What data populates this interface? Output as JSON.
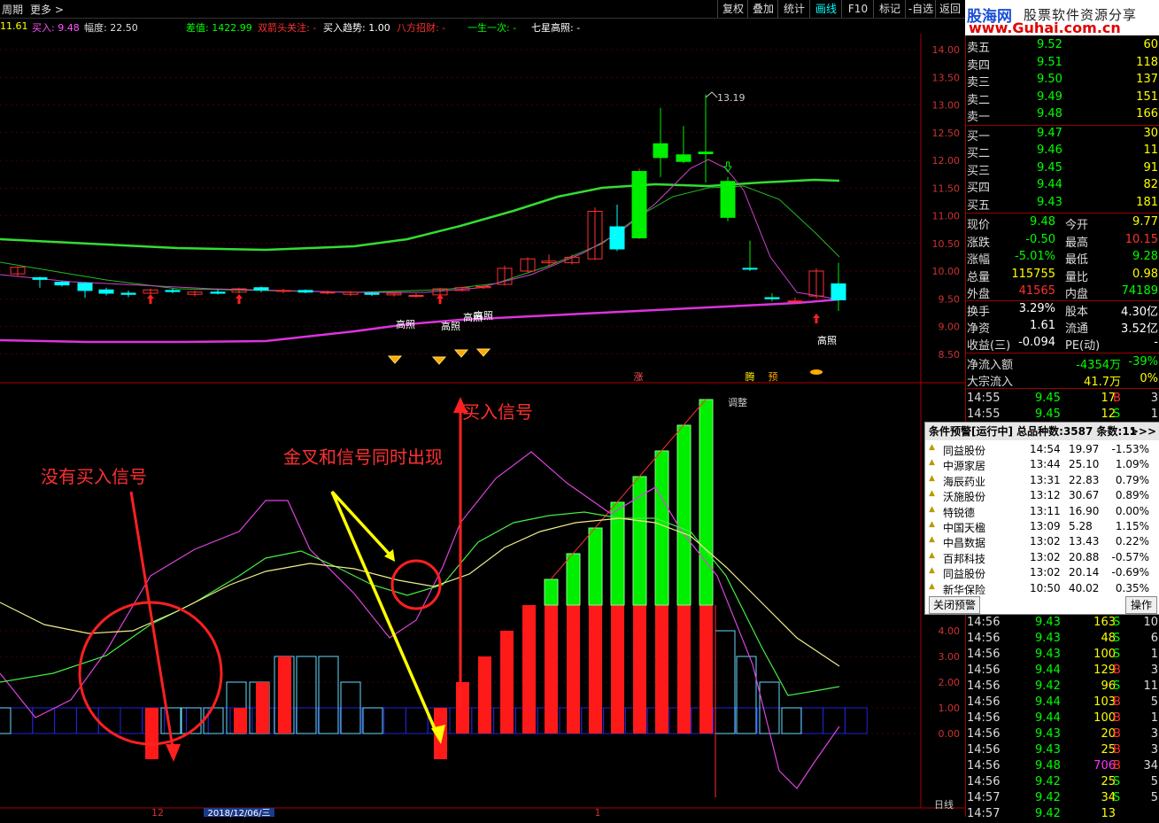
{
  "toolbar": {
    "left_items": [
      "周期",
      "更多 >"
    ],
    "buttons": [
      {
        "label": "复权",
        "active": false
      },
      {
        "label": "叠加",
        "active": false
      },
      {
        "label": "统计",
        "active": false
      },
      {
        "label": "画线",
        "active": true
      },
      {
        "label": "F10",
        "active": false
      },
      {
        "label": "标记",
        "active": false
      },
      {
        "label": "-自选",
        "active": false
      },
      {
        "label": "返回",
        "active": false
      }
    ]
  },
  "infobar": [
    {
      "text": "11.61",
      "color": "#ffff00"
    },
    {
      "text": "买入: 9.48",
      "color": "#ff55ff"
    },
    {
      "text": "幅度: 22.50",
      "color": "#dddddd"
    },
    {
      "text": "差值: 1422.99",
      "color": "#00ff00"
    },
    {
      "text": "双箭头关注: -",
      "color": "#ff3030"
    },
    {
      "text": "买入趋势: 1.00",
      "color": "#ffffff"
    },
    {
      "text": "八方招财: -",
      "color": "#ff3030"
    },
    {
      "text": "一生一次: -",
      "color": "#00ff00"
    },
    {
      "text": "七星高照: -",
      "color": "#ffffff"
    }
  ],
  "price_axis": [
    "14.00",
    "13.50",
    "13.00",
    "12.50",
    "12.00",
    "11.50",
    "11.00",
    "10.50",
    "10.00",
    "9.50",
    "9.00",
    "8.50"
  ],
  "indicator_axis": [
    "4.00",
    "3.00",
    "2.00",
    "1.00",
    "0.00"
  ],
  "chart_labels": {
    "high_label": "13.19",
    "gaozhao": [
      "高照",
      "高照",
      "高照",
      "高照",
      "高照"
    ],
    "zhang": "涨",
    "teng": "腾",
    "yu": "预",
    "date_label": "2018/12/06/三",
    "axis_tick_12": "12",
    "axis_tick_1": "1",
    "period": "日线",
    "ind_top_label": "调整"
  },
  "annotations": {
    "no_buy_signal": "没有买入信号",
    "golden_cross": "金叉和信号同时出现",
    "buy_signal": "买入信号"
  },
  "logo": {
    "name": "股海网",
    "slogan": "股票软件资源分享",
    "url": "www.Guhai.com.cn"
  },
  "quote_book": [
    {
      "label": "卖五",
      "price": "9.52",
      "vol": "60"
    },
    {
      "label": "卖四",
      "price": "9.51",
      "vol": "118"
    },
    {
      "label": "卖三",
      "price": "9.50",
      "vol": "137"
    },
    {
      "label": "卖二",
      "price": "9.49",
      "vol": "151"
    },
    {
      "label": "卖一",
      "price": "9.48",
      "vol": "166"
    },
    {
      "label": "买一",
      "price": "9.47",
      "vol": "30"
    },
    {
      "label": "买二",
      "price": "9.46",
      "vol": "11"
    },
    {
      "label": "买三",
      "price": "9.45",
      "vol": "91"
    },
    {
      "label": "买四",
      "price": "9.44",
      "vol": "82"
    },
    {
      "label": "买五",
      "price": "9.43",
      "vol": "181"
    }
  ],
  "stats": [
    {
      "l1": "现价",
      "v1": "9.48",
      "c1": "#00ff00",
      "l2": "今开",
      "v2": "9.77",
      "c2": "#ffff00"
    },
    {
      "l1": "涨跌",
      "v1": "-0.50",
      "c1": "#00ff00",
      "l2": "最高",
      "v2": "10.15",
      "c2": "#ff3030"
    },
    {
      "l1": "涨幅",
      "v1": "-5.01%",
      "c1": "#00ff00",
      "l2": "最低",
      "v2": "9.28",
      "c2": "#00ff00"
    },
    {
      "l1": "总量",
      "v1": "115755",
      "c1": "#ffff00",
      "l2": "量比",
      "v2": "0.98",
      "c2": "#ffff00"
    },
    {
      "l1": "外盘",
      "v1": "41565",
      "c1": "#ff3030",
      "l2": "内盘",
      "v2": "74189",
      "c2": "#00ff00"
    }
  ],
  "stats2": [
    {
      "l1": "换手",
      "v1": "3.29%",
      "c1": "#ffffff",
      "l2": "股本",
      "v2": "4.30亿",
      "c2": "#ffffff"
    },
    {
      "l1": "净资",
      "v1": "1.61",
      "c1": "#ffffff",
      "l2": "流通",
      "v2": "3.52亿",
      "c2": "#ffffff"
    },
    {
      "l1": "收益(三)",
      "v1": "-0.094",
      "c1": "#ffffff",
      "l2": "PE(动)",
      "v2": "-",
      "c2": "#ffffff"
    }
  ],
  "flows": [
    {
      "label": "净流入额",
      "v1": "-4354万",
      "v2": "-39%",
      "c": "#00ff00"
    },
    {
      "label": "大宗流入",
      "v1": "41.7万",
      "v2": "0%",
      "c": "#ffff00"
    }
  ],
  "ticks": [
    {
      "t": "14:55",
      "p": "9.45",
      "v": "17",
      "bs": "B",
      "n": "3"
    },
    {
      "t": "14:55",
      "p": "9.45",
      "v": "12",
      "bs": "S",
      "n": "1"
    },
    {
      "t": "14:56",
      "p": "9.43",
      "v": "163",
      "bs": "S",
      "n": "10"
    },
    {
      "t": "14:56",
      "p": "9.43",
      "v": "48",
      "bs": "S",
      "n": "6"
    },
    {
      "t": "14:56",
      "p": "9.43",
      "v": "100",
      "bs": "S",
      "n": "1"
    },
    {
      "t": "14:56",
      "p": "9.44",
      "v": "129",
      "bs": "B",
      "n": "3"
    },
    {
      "t": "14:56",
      "p": "9.42",
      "v": "96",
      "bs": "S",
      "n": "11"
    },
    {
      "t": "14:56",
      "p": "9.44",
      "v": "103",
      "bs": "B",
      "n": "5"
    },
    {
      "t": "14:56",
      "p": "9.44",
      "v": "100",
      "bs": "B",
      "n": "1"
    },
    {
      "t": "14:56",
      "p": "9.43",
      "v": "20",
      "bs": "B",
      "n": "3"
    },
    {
      "t": "14:56",
      "p": "9.43",
      "v": "25",
      "bs": "B",
      "n": "3"
    },
    {
      "t": "14:56",
      "p": "9.48",
      "v": "706",
      "bs": "B",
      "n": "34"
    },
    {
      "t": "14:56",
      "p": "9.42",
      "v": "25",
      "bs": "S",
      "n": "5"
    },
    {
      "t": "14:57",
      "p": "9.42",
      "v": "34",
      "bs": "S",
      "n": "5"
    },
    {
      "t": "14:57",
      "p": "9.42",
      "v": "13",
      "bs": "",
      "n": ""
    }
  ],
  "alert": {
    "title": "条件预警[运行中] 总品种数:3587 条数:11",
    "more": ">>>",
    "rows": [
      {
        "name": "同益股份",
        "time": "14:54",
        "price": "19.97",
        "pct": "-1.53%"
      },
      {
        "name": "中源家居",
        "time": "13:44",
        "price": "25.10",
        "pct": "1.09%"
      },
      {
        "name": "海辰药业",
        "time": "13:31",
        "price": "22.83",
        "pct": "0.79%"
      },
      {
        "name": "沃施股份",
        "time": "13:12",
        "price": "30.67",
        "pct": "0.89%"
      },
      {
        "name": "特锐德",
        "time": "13:11",
        "price": "16.90",
        "pct": "0.00%"
      },
      {
        "name": "中国天楹",
        "time": "13:09",
        "price": "5.28",
        "pct": "1.15%"
      },
      {
        "name": "中昌数据",
        "time": "13:02",
        "price": "13.43",
        "pct": "0.22%"
      },
      {
        "name": "百邦科技",
        "time": "13:02",
        "price": "20.88",
        "pct": "-0.57%"
      },
      {
        "name": "同益股份",
        "time": "13:02",
        "price": "20.14",
        "pct": "-0.69%"
      },
      {
        "name": "新华保险",
        "time": "10:50",
        "price": "40.02",
        "pct": "0.35%"
      }
    ],
    "close_label": "关闭预警",
    "op_label": "操作"
  }
}
